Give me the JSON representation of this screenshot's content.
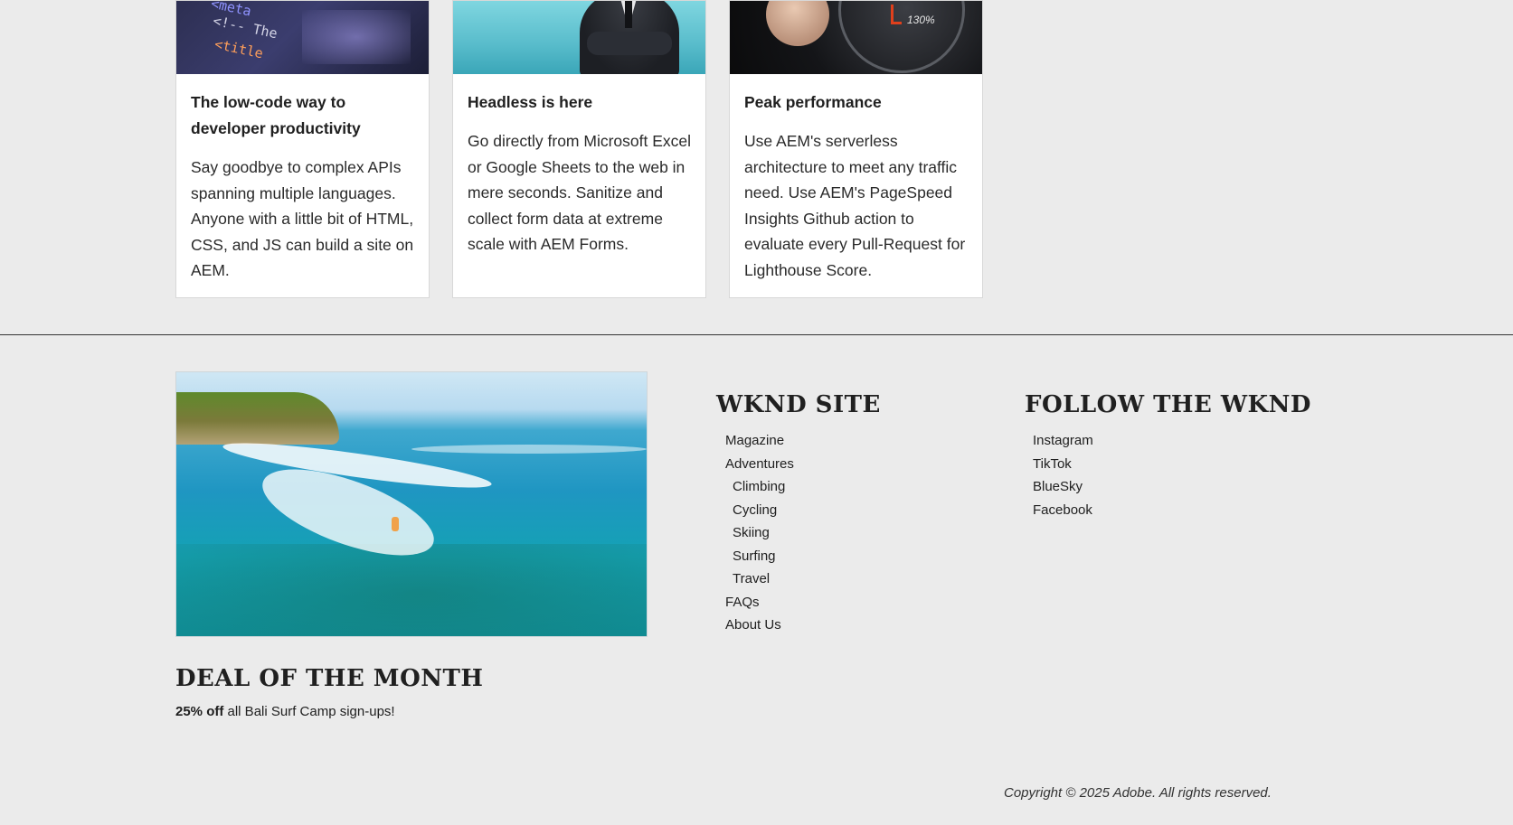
{
  "cards": [
    {
      "title": "The low-code way to developer productivity",
      "text": "Say goodbye to complex APIs spanning multiple languages. Anyone with a little bit of HTML, CSS, and JS can build a site on AEM.",
      "image_code": [
        "<meta",
        "<!-- The",
        "<title"
      ]
    },
    {
      "title": "Headless is here",
      "text": "Go directly from Microsoft Excel or Google Sheets to the web in mere seconds. Sanitize and collect form data at extreme scale with AEM Forms."
    },
    {
      "title": "Peak performance",
      "text": "Use AEM's serverless architecture to meet any traffic need. Use AEM's PageSpeed Insights Github action to evaluate every Pull-Request for Lighthouse Score.",
      "image_gauge_label": "130%"
    }
  ],
  "footer": {
    "site_heading": "WKND SITE",
    "site_links": [
      {
        "label": "Magazine",
        "sub": false
      },
      {
        "label": "Adventures",
        "sub": false
      },
      {
        "label": "Climbing",
        "sub": true
      },
      {
        "label": "Cycling",
        "sub": true
      },
      {
        "label": "Skiing",
        "sub": true
      },
      {
        "label": "Surfing",
        "sub": true
      },
      {
        "label": "Travel",
        "sub": true
      },
      {
        "label": "FAQs",
        "sub": false
      },
      {
        "label": "About Us",
        "sub": false
      }
    ],
    "follow_heading": "FOLLOW THE WKND",
    "follow_links": [
      "Instagram",
      "TikTok",
      "BlueSky",
      "Facebook"
    ],
    "deal_heading": "DEAL OF THE MONTH",
    "deal_bold": "25% off",
    "deal_rest": " all Bali Surf Camp sign-ups!",
    "copyright": "Copyright © 2025 Adobe. All rights reserved."
  },
  "colors": {
    "background": "#ebebeb",
    "card_bg": "#ffffff",
    "text": "#202020",
    "divider": "#333333"
  }
}
